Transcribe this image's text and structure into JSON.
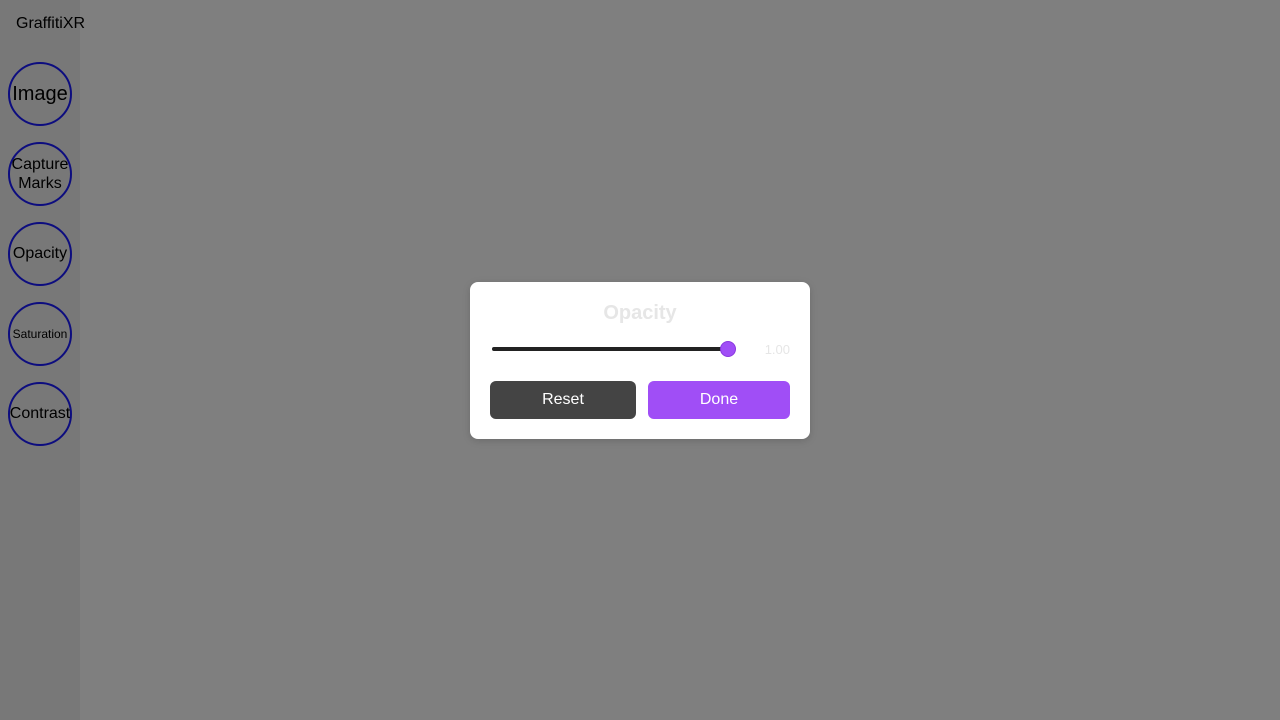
{
  "app": {
    "title": "GraffitiXR"
  },
  "sidebar": {
    "items": [
      {
        "label": "Image"
      },
      {
        "label": "Capture\nMarks"
      },
      {
        "label": "Opacity"
      },
      {
        "label": "Saturation"
      },
      {
        "label": "Contrast"
      }
    ]
  },
  "dialog": {
    "title": "Opacity",
    "slider": {
      "value": 1.0,
      "min": 0,
      "max": 1,
      "value_label": "1.00"
    },
    "reset_label": "Reset",
    "done_label": "Done"
  },
  "colors": {
    "accent": "#a04ef6",
    "nav_border": "#1a1aff",
    "reset_button": "#444444",
    "overlay": "rgba(0,0,0,0.5)"
  }
}
